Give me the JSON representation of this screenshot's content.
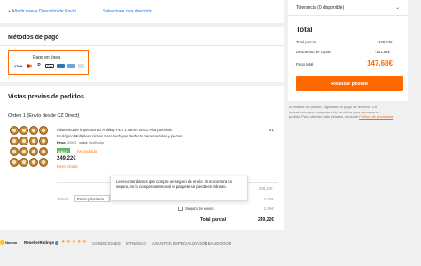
{
  "address": {
    "add_link": "+ Añadir nueva Dirección de Envío",
    "select_link": "Seleccione otra dirección"
  },
  "payment": {
    "title": "Métodos de pago",
    "option_label": "Pago en línea",
    "icons": [
      "visa-icon",
      "mastercard-icon",
      "paypal-icon",
      "applepay-icon",
      "amex-icon",
      "card-icon",
      "other-icon"
    ]
  },
  "preview": {
    "title": "Vistas previas de pedidos",
    "order_label": "Orden 1 (Envío desde CZ Direct)",
    "product_name_line1": "Filamento de impresoa 3D Artillery PLA 1.75mm 20KG Alta precisión",
    "product_name_line2": "Ecológico Múltiples colores Cero burbujas Perfecto para modelos y piezas...",
    "weight_label": "Peso:",
    "weight_value": "20KG",
    "color_label": "color:",
    "color_value": "Multicolor",
    "quantity": "x1",
    "sale_badge": "SALE",
    "vat_text": "IVA incluido",
    "price": "249,22€",
    "free_shipping": "Envío Gratis",
    "shipping_label": "Envío:",
    "shipping_option": "Envío prioritario",
    "subtotal_value": "249,22€",
    "shipping_value": "0,00€",
    "insurance_label": "Seguro de envío",
    "insurance_value": "2,99€",
    "total_label": "Total parcial",
    "total_value": "249,22€",
    "tooltip_text": "Le recomendamos que compre un seguro de envío. Si no compra un seguro, no lo compensaremos si el paquete se pierde en tránsito."
  },
  "summary": {
    "tolerance_label": "Tolerancia (0 disponible)",
    "title": "Total",
    "subtotal_label": "Total parcial",
    "subtotal_value": "249,22€",
    "coupon_label": "Descuento de cupón",
    "coupon_value": "-101,54€",
    "pay_total_label": "Pago total",
    "pay_total_value": "147,68€",
    "button_label": "Realizar pedido",
    "legal_line1": "Al realizar un pedido, ingresará un pago de terceros. La",
    "legal_line2": "información que comparta sólo se utiliza para procesar su",
    "legal_line3": "pedido. Para obtener más detalles, consulte ",
    "legal_link": "Política de privacidad"
  },
  "footer": {
    "norton_label": "Norton",
    "reseller_label": "ResellerRatings",
    "links": [
      "CONDICIONES",
      "INTIMIDAD",
      "ASUNTOS ESPECIALIZADOS",
      "© BANGGOOD"
    ]
  },
  "colors": {
    "accent": "#ff6a00",
    "link": "#1a73e8",
    "sale_green": "#5cb85c"
  }
}
